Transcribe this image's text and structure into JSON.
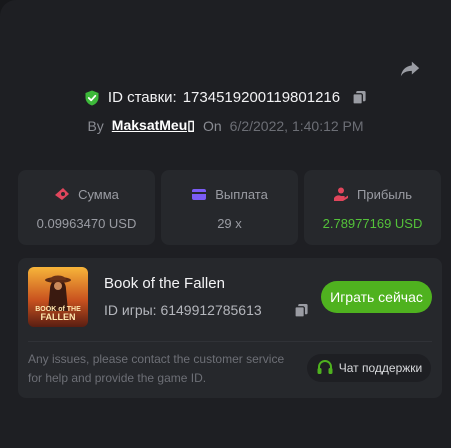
{
  "bet": {
    "id_label": "ID ставки:",
    "id_value": "1734519200119801216",
    "by_label": "By",
    "username": "MaksatMeu▯",
    "on_label": "On",
    "timestamp": "6/2/2022, 1:40:12 PM"
  },
  "stats": [
    {
      "label": "Сумма",
      "value": "0.09963470 USD",
      "icon": "bet-amount-icon",
      "color": "#e0465c"
    },
    {
      "label": "Выплата",
      "value": "29 x",
      "icon": "wallet-icon",
      "color": "#7b5cf5"
    },
    {
      "label": "Прибыль",
      "value": "2.78977169 USD",
      "icon": "profit-hand-icon",
      "color": "#e0465c"
    }
  ],
  "game": {
    "title": "Book of the Fallen",
    "id_text": "ID игры: 6149912785613",
    "thumb_text": "BOOK of THE FALLEN",
    "play_label": "Играть сейчас"
  },
  "support": {
    "issue_text": "Any issues, please contact the customer service for help and provide the game ID.",
    "button_label": "Чат поддержки"
  },
  "colors": {
    "accent_green": "#4fb21f",
    "profit_green": "#54c23a",
    "background": "#1e1f23",
    "card": "#26282c"
  }
}
